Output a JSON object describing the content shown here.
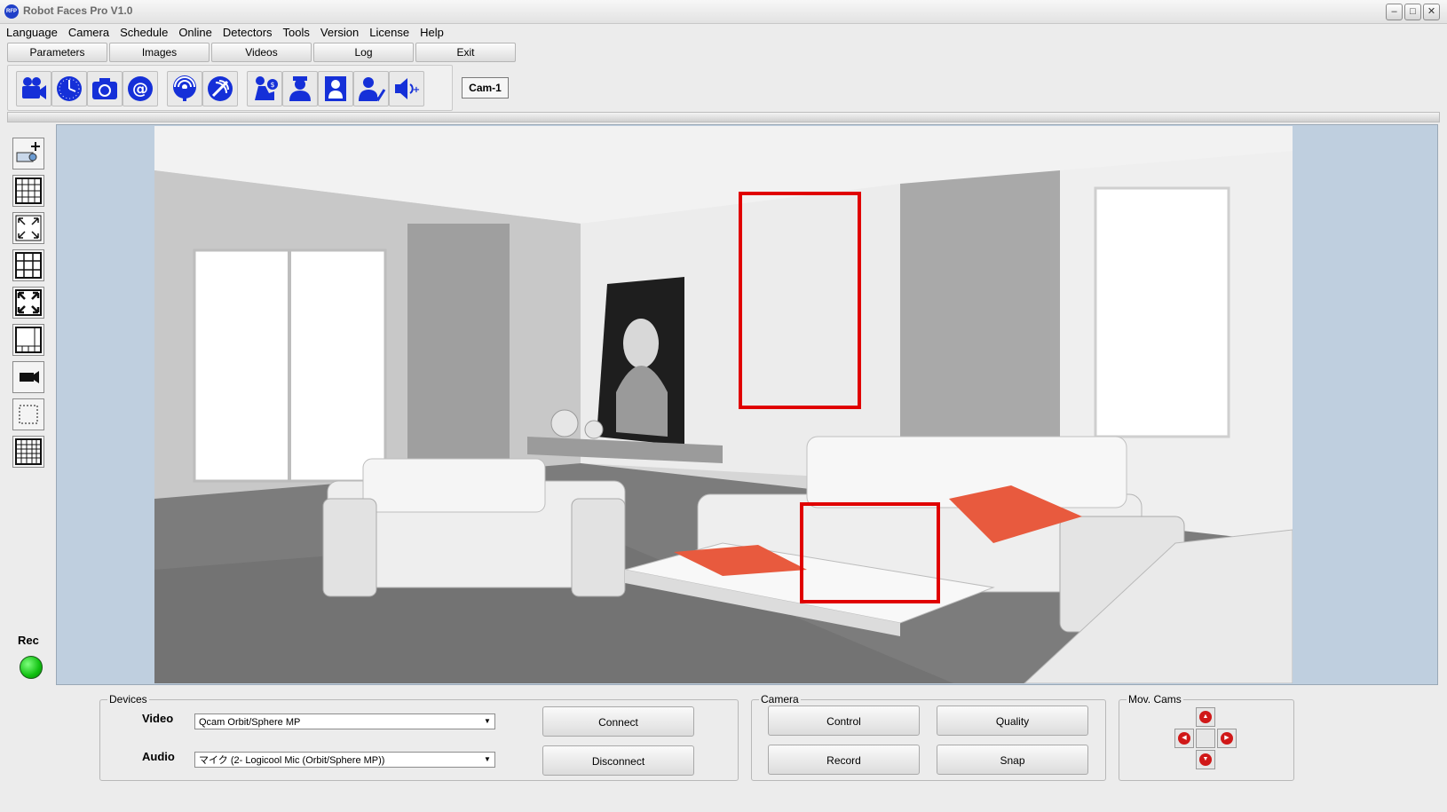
{
  "window": {
    "logo_text": "RFP",
    "title": "Robot Faces Pro V1.0"
  },
  "menu": [
    "Language",
    "Camera",
    "Schedule",
    "Online",
    "Detectors",
    "Tools",
    "Version",
    "License",
    "Help"
  ],
  "nav_buttons": [
    "Parameters",
    "Images",
    "Videos",
    "Log",
    "Exit"
  ],
  "toolbar_icons": [
    "video-camera-icon",
    "schedule-clock-icon",
    "photo-camera-icon",
    "email-icon",
    "broadcast-icon",
    "satellite-icon",
    "thief-icon",
    "police-icon",
    "user-icon",
    "user-check-icon",
    "speaker-plus-icon"
  ],
  "camera_label": "Cam-1",
  "left_tools": [
    "add-camera-icon",
    "grid-4x4-icon",
    "fullscreen-icon",
    "grid-3x3-icon",
    "fullscreen-bold-icon",
    "grid-layout-icon",
    "camera-side-icon",
    "selection-icon",
    "multi-grid-icon"
  ],
  "rec": {
    "label": "Rec",
    "status_color": "#22d022"
  },
  "detection": {
    "box_color": "#e00000"
  },
  "devices": {
    "title": "Devices",
    "video_label": "Video",
    "video_value": "Qcam Orbit/Sphere MP",
    "audio_label": "Audio",
    "audio_value": "マイク (2- Logicool Mic (Orbit/Sphere MP))",
    "connect": "Connect",
    "disconnect": "Disconnect"
  },
  "camera": {
    "title": "Camera",
    "control": "Control",
    "quality": "Quality",
    "record": "Record",
    "snap": "Snap"
  },
  "mov_cams": {
    "title": "Mov. Cams"
  }
}
